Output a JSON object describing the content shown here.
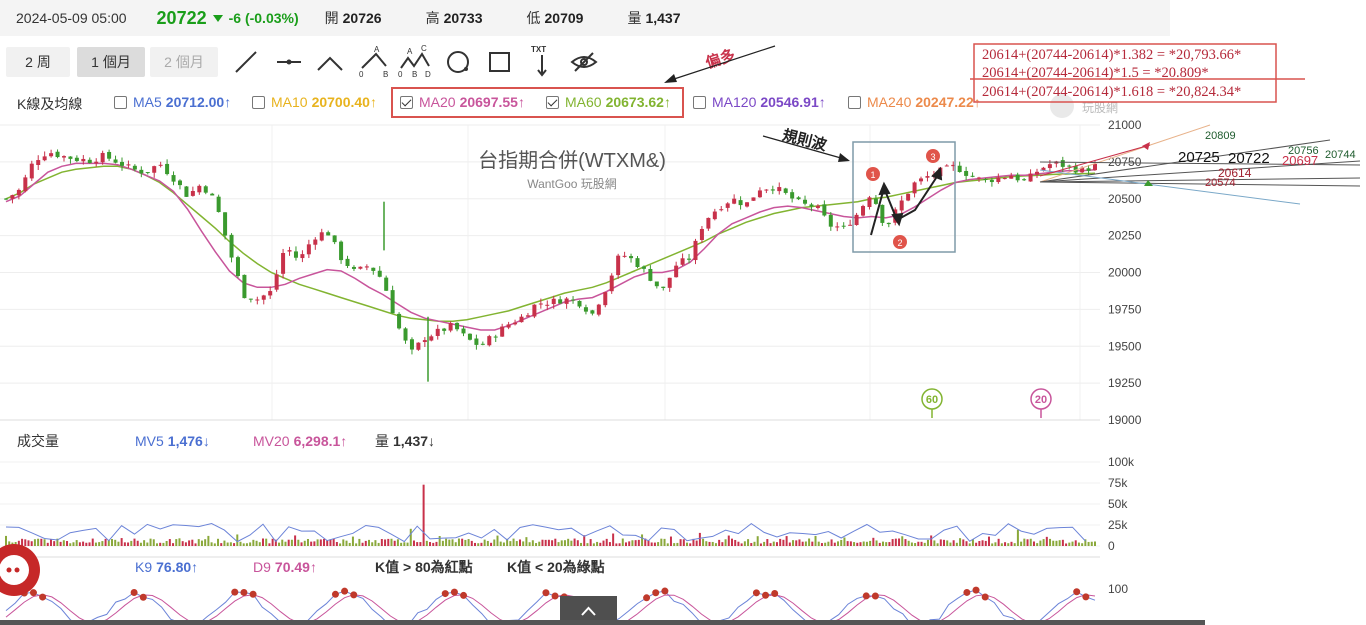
{
  "header": {
    "datetime": "2024-05-09 05:00",
    "price": "20722",
    "change": "-6 (-0.03%)",
    "open_label": "開",
    "open_value": "20726",
    "high_label": "高",
    "high_value": "20733",
    "low_label": "低",
    "low_value": "20709",
    "volume_label": "量",
    "volume_value": "1,437"
  },
  "toolbar": {
    "range_buttons": [
      "2 周",
      "1 個月",
      "2 個月"
    ],
    "active_range": "1 個月",
    "tools": [
      "trend-line-tool",
      "horizontal-line-tool",
      "wedge-tool",
      "abc-wave-tool",
      "abcd-wave-tool",
      "circle-tool",
      "rectangle-tool",
      "text-tool",
      "hide-drawings-tool"
    ],
    "tool_letters": {
      "A": "A",
      "B": "B",
      "C": "C",
      "D": "D",
      "zero": "0",
      "txt": "TXT"
    }
  },
  "ma_legend": {
    "title": "K線及均線",
    "items": [
      {
        "name": "MA5",
        "value": "20712.00",
        "arrow": "↑",
        "checked": false,
        "color": "#4a6fd1"
      },
      {
        "name": "MA10",
        "value": "20700.40",
        "arrow": "↑",
        "checked": false,
        "color": "#e8b31e"
      },
      {
        "name": "MA20",
        "value": "20697.55",
        "arrow": "↑",
        "checked": true,
        "color": "#c8559b"
      },
      {
        "name": "MA60",
        "value": "20673.62",
        "arrow": "↑",
        "checked": true,
        "color": "#82b431"
      },
      {
        "name": "MA120",
        "value": "20546.91",
        "arrow": "↑",
        "checked": false,
        "color": "#7b48c6"
      },
      {
        "name": "MA240",
        "value": "20247.22",
        "arrow": "↑",
        "checked": false,
        "color": "#ec8a4b"
      }
    ]
  },
  "annotations": {
    "bias_label": "偏多",
    "regular_wave_label": "規則波",
    "wave_markers": [
      "1",
      "2",
      "3"
    ],
    "ma_badges": [
      "60",
      "20"
    ]
  },
  "fib_lines": [
    "20614+(20744-20614)*1.382 = *20,793.66*",
    "20614+(20744-20614)*1.5 = *20.809*",
    "20614+(20744-20614)*1.618 = *20,824.34*"
  ],
  "right_labels": [
    {
      "text": "20809",
      "color": "#1f5c2e"
    },
    {
      "text": "20756",
      "color": "#1f5c2e"
    },
    {
      "text": "20744",
      "color": "#1f5c2e"
    },
    {
      "text": "20725",
      "color": "#111111"
    },
    {
      "text": "20722",
      "color": "#111111"
    },
    {
      "text": "20697",
      "color": "#c8314a"
    },
    {
      "text": "20614",
      "color": "#a0202f"
    },
    {
      "text": "20574",
      "color": "#a0202f"
    }
  ],
  "watermark": {
    "title": "台指期合併(WTXM&)",
    "subtitle": "WantGoo 玩股網",
    "logo_text": "玩股網"
  },
  "volume_legend": {
    "title": "成交量",
    "mv5_name": "MV5",
    "mv5_value": "1,476",
    "mv5_arrow": "↓",
    "mv20_name": "MV20",
    "mv20_value": "6,298.1",
    "mv20_arrow": "↑",
    "vol_name": "量",
    "vol_value": "1,437",
    "vol_arrow": "↓"
  },
  "kd_legend": {
    "k_name": "K9",
    "k_value": "76.80",
    "k_arrow": "↑",
    "d_name": "D9",
    "d_value": "70.49",
    "d_arrow": "↑",
    "note1": "K值 > 80為紅點",
    "note2": "K值 < 20為綠點"
  },
  "colors": {
    "up": "#c8314a",
    "down": "#3a9a2e",
    "ma20": "#c8559b",
    "ma60": "#82b431",
    "accent_green": "#1a9e1a",
    "highlight_red": "#d9534f"
  },
  "chart_data": {
    "type": "candlestick",
    "title": "台指期合併(WTXM&)",
    "price_axis": {
      "ticks": [
        "21000",
        "20750",
        "20500",
        "20250",
        "20000",
        "19750",
        "19500",
        "19250",
        "19000"
      ],
      "ylim": [
        19000,
        21000
      ]
    },
    "volume_axis": {
      "ticks": [
        "100k",
        "75k",
        "50k",
        "25k",
        "0"
      ],
      "ylim": [
        0,
        100000
      ]
    },
    "kd_axis": {
      "ticks": [
        "100"
      ]
    },
    "ohlc_path": [
      20500,
      20560,
      20760,
      20820,
      20790,
      20770,
      20760,
      20790,
      20750,
      20700,
      20680,
      20740,
      20640,
      20520,
      20600,
      20480,
      20150,
      19850,
      19820,
      19870,
      20180,
      20080,
      20240,
      20280,
      20100,
      20000,
      20050,
      19950,
      19650,
      19450,
      19560,
      19600,
      19640,
      19550,
      19500,
      19580,
      19650,
      19700,
      19790,
      19800,
      19820,
      19800,
      19720,
      19900,
      20130,
      20080,
      19980,
      19870,
      20050,
      20100,
      20350,
      20440,
      20500,
      20460,
      20570,
      20580,
      20520,
      20460,
      20450,
      20320,
      20300,
      20400,
      20550,
      20300,
      20460,
      20600,
      20650,
      20690,
      20720,
      20660,
      20620,
      20640,
      20660,
      20614,
      20700,
      20744,
      20720,
      20690,
      20722
    ],
    "ma20": [
      20480,
      20520,
      20600,
      20680,
      20720,
      20740,
      20740,
      20740,
      20730,
      20700,
      20660,
      20620,
      20550,
      20430,
      20280,
      20140,
      20010,
      19930,
      19900,
      19900,
      19920,
      19960,
      19990,
      20020,
      20010,
      19960,
      19900,
      19850,
      19790,
      19730,
      19690,
      19670,
      19650,
      19630,
      19610,
      19610,
      19640,
      19680,
      19720,
      19760,
      19800,
      19820,
      19830,
      19870,
      19920,
      19970,
      20000,
      20000,
      20020,
      20070,
      20160,
      20260,
      20330,
      20370,
      20410,
      20440,
      20450,
      20440,
      20420,
      20400,
      20380,
      20370,
      20380,
      20370,
      20390,
      20440,
      20500,
      20560,
      20610,
      20630,
      20640,
      20650,
      20660,
      20660,
      20670,
      20680,
      20690,
      20690,
      20697
    ],
    "ma60": [
      20500,
      20540,
      20600,
      20640,
      20680,
      20700,
      20710,
      20720,
      20720,
      20700,
      20660,
      20610,
      20540,
      20460,
      20380,
      20300,
      20210,
      20130,
      20060,
      20000,
      19960,
      19920,
      19890,
      19860,
      19830,
      19800,
      19770,
      19740,
      19710,
      19690,
      19680,
      19670,
      19670,
      19680,
      19700,
      19720,
      19740,
      19770,
      19800,
      19830,
      19860,
      19880,
      19900,
      19930,
      19970,
      20010,
      20050,
      20090,
      20130,
      20170,
      20210,
      20260,
      20300,
      20340,
      20370,
      20400,
      20420,
      20440,
      20450,
      20460,
      20470,
      20480,
      20500,
      20510,
      20530,
      20550,
      20570,
      20590,
      20610,
      20620,
      20630,
      20640,
      20650,
      20655,
      20660,
      20665,
      20668,
      20670,
      20673
    ],
    "volume_spikes": [
      0.12,
      0.1,
      0.08,
      0.09,
      0.07,
      0.06,
      0.08,
      0.12,
      0.1,
      0.08,
      0.07,
      0.12,
      0.1,
      0.08,
      0.14,
      0.1,
      0.16,
      0.12,
      0.1,
      0.08,
      0.14,
      0.12,
      0.1,
      0.08,
      0.18,
      0.1,
      0.12,
      0.08,
      0.73,
      0.2,
      0.14,
      0.12,
      0.1,
      0.08,
      0.1,
      0.12,
      0.14,
      0.1,
      0.12,
      0.08,
      0.1,
      0.12,
      0.14,
      0.1,
      0.2,
      0.16,
      0.12,
      0.1,
      0.12,
      0.1,
      0.18,
      0.14,
      0.12,
      0.1,
      0.12,
      0.1,
      0.12,
      0.08,
      0.12,
      0.14,
      0.1,
      0.12,
      0.1,
      0.08,
      0.12,
      0.1,
      0.12,
      0.14,
      0.1,
      0.08,
      0.12,
      0.1,
      0.28,
      0.1,
      0.12,
      0.1,
      0.08,
      0.06,
      0.05
    ]
  }
}
